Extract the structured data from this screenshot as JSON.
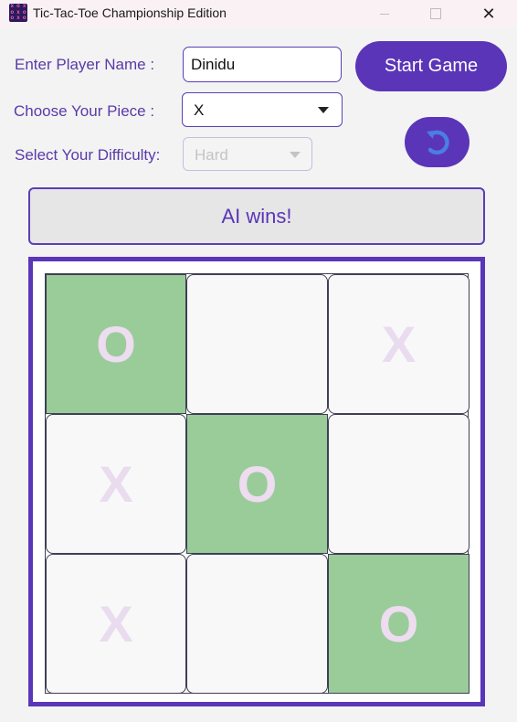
{
  "window": {
    "title": "Tic-Tac-Toe Championship Edition",
    "icon_glyphs": [
      "x",
      "o",
      "x",
      "o",
      "x",
      "o",
      "o",
      "x",
      "o"
    ],
    "minimize_icon": "minimize-icon",
    "maximize_icon": "maximize-icon",
    "close_icon": "close-icon",
    "close_glyph": "✕"
  },
  "form": {
    "player_name_label": "Enter Player Name :",
    "player_name_value": "Dinidu",
    "piece_label": "Choose Your Piece :",
    "piece_value": "X",
    "difficulty_label": "Select Your Difficulty:",
    "difficulty_value": "Hard",
    "difficulty_disabled": true,
    "start_button_label": "Start Game",
    "reset_icon": "refresh-icon"
  },
  "status": {
    "text": "AI wins!"
  },
  "board": {
    "cells": [
      {
        "mark": "O",
        "winning": true
      },
      {
        "mark": "",
        "winning": false
      },
      {
        "mark": "X",
        "winning": false
      },
      {
        "mark": "X",
        "winning": false
      },
      {
        "mark": "O",
        "winning": true
      },
      {
        "mark": "",
        "winning": false
      },
      {
        "mark": "X",
        "winning": false
      },
      {
        "mark": "",
        "winning": false
      },
      {
        "mark": "O",
        "winning": true
      }
    ]
  },
  "colors": {
    "accent": "#5b35b8",
    "win_cell": "#99cc99",
    "mark": "#eadcef",
    "reset_arrow": "#4a7fe0"
  }
}
